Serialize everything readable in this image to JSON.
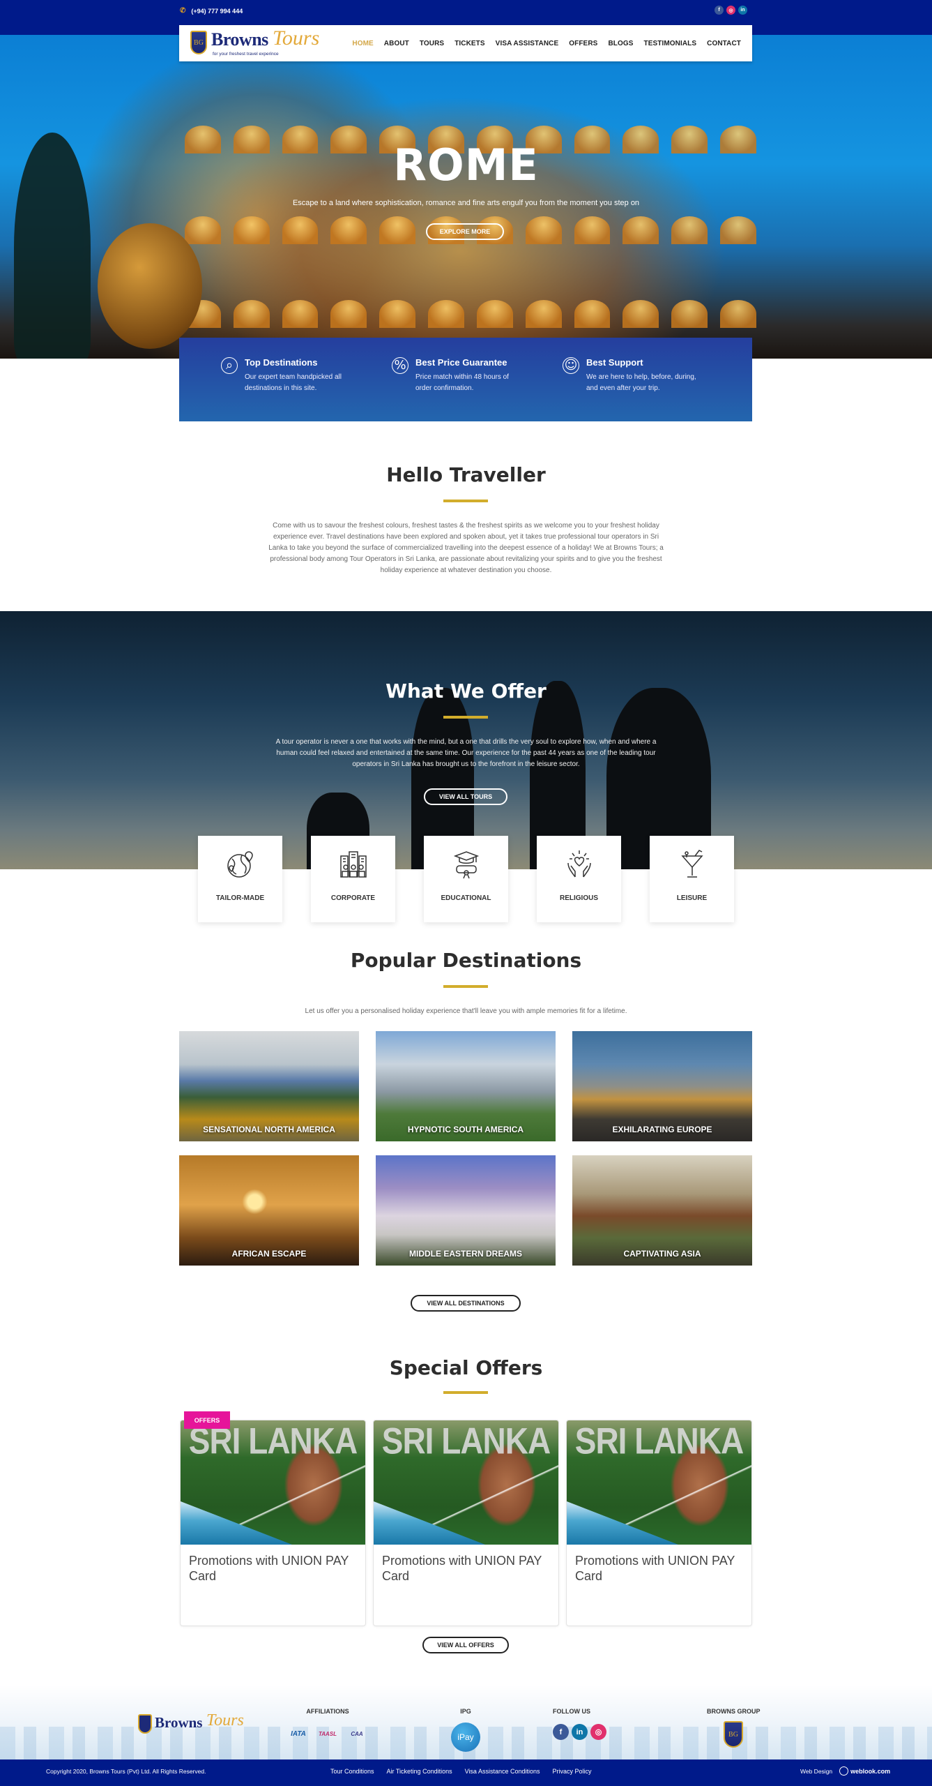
{
  "topbar": {
    "phone": "(+94) 777 994 444",
    "socials": [
      {
        "name": "facebook",
        "glyph": "f"
      },
      {
        "name": "instagram",
        "glyph": "◎"
      },
      {
        "name": "linkedin",
        "glyph": "in"
      }
    ]
  },
  "header": {
    "logo_brand": "Browns",
    "logo_script": "Tours",
    "logo_tagline": "for your freshest travel experince",
    "logo_monogram": "BG",
    "nav": [
      {
        "label": "HOME",
        "active": true
      },
      {
        "label": "ABOUT"
      },
      {
        "label": "TOURS"
      },
      {
        "label": "TICKETS"
      },
      {
        "label": "VISA ASSISTANCE"
      },
      {
        "label": "OFFERS"
      },
      {
        "label": "BLOGS"
      },
      {
        "label": "TESTIMONIALS"
      },
      {
        "label": "CONTACT"
      }
    ],
    "active_color": "#d4a84a"
  },
  "hero": {
    "title": "ROME",
    "subtitle": "Escape to a land where sophistication, romance and fine arts engulf you from the moment you step on",
    "button": "EXPLORE MORE"
  },
  "features": [
    {
      "icon": "globe-search-icon",
      "glyph": "⌕",
      "title": "Top Destinations",
      "text": "Our expert team handpicked all destinations in this site."
    },
    {
      "icon": "percent-badge-icon",
      "glyph": "%",
      "title": "Best Price Guarantee",
      "text": "Price match within 48 hours of order confirmation."
    },
    {
      "icon": "support-people-icon",
      "glyph": "☺",
      "title": "Best Support",
      "text": "We are here to help, before, during, and even after your trip."
    }
  ],
  "hello": {
    "title": "Hello Traveller",
    "text": "Come with us to savour the freshest colours, freshest tastes & the freshest spirits as we welcome you to your freshest holiday experience ever. Travel destinations have been explored and spoken about, yet it takes true professional tour operators in Sri Lanka to take you beyond the surface of commercialized travelling into the deepest essence of a holiday! We at Browns Tours; a professional body among Tour Operators in Sri Lanka, are passionate about revitalizing your spirits and to give you the freshest holiday experience at whatever destination you choose."
  },
  "offer": {
    "title": "What We Offer",
    "text": "A tour operator is never a one that works with the mind, but a one that drills the very soul to explore how, when and where a human could feel relaxed and entertained at the same time. Our experience for the past 44 years as one of the leading tour operators in Sri Lanka has brought us to the forefront in the leisure sector.",
    "button": "VIEW ALL TOURS",
    "categories": [
      {
        "label": "TAILOR-MADE",
        "icon": "globe-pins-icon"
      },
      {
        "label": "CORPORATE",
        "icon": "buildings-people-icon"
      },
      {
        "label": "EDUCATIONAL",
        "icon": "graduation-cap-icon"
      },
      {
        "label": "RELIGIOUS",
        "icon": "hands-heart-icon"
      },
      {
        "label": "LEISURE",
        "icon": "cocktail-icon"
      }
    ]
  },
  "destinations": {
    "title": "Popular Destinations",
    "subtitle": "Let us offer you a personalised holiday experience that'll leave you with ample memories fit for a lifetime.",
    "items": [
      {
        "label": "SENSATIONAL NORTH AMERICA"
      },
      {
        "label": "HYPNOTIC SOUTH AMERICA"
      },
      {
        "label": "EXHILARATING EUROPE"
      },
      {
        "label": "AFRICAN ESCAPE"
      },
      {
        "label": "MIDDLE EASTERN DREAMS"
      },
      {
        "label": "CAPTIVATING ASIA"
      }
    ],
    "button": "VIEW ALL DESTINATIONS"
  },
  "special_offers": {
    "title": "Special Offers",
    "badge": "OFFERS",
    "badge_color": "#e6149a",
    "items": [
      {
        "image_text": "SRI LANKA",
        "title": "Promotions with UNION PAY Card"
      },
      {
        "image_text": "SRI LANKA",
        "title": "Promotions with UNION PAY Card"
      },
      {
        "image_text": "SRI LANKA",
        "title": "Promotions with UNION PAY Card"
      }
    ],
    "button": "VIEW ALL OFFERS"
  },
  "footer": {
    "affiliations_heading": "AFFILIATIONS",
    "affiliations": [
      "IATA",
      "TAASL",
      "CAA"
    ],
    "ipg_heading": "IPG",
    "ipg_label": "iPay",
    "follow_heading": "FOLLOW US",
    "follow": [
      {
        "name": "facebook",
        "glyph": "f"
      },
      {
        "name": "linkedin",
        "glyph": "in"
      },
      {
        "name": "instagram",
        "glyph": "◎"
      }
    ],
    "group_heading": "BROWNS GROUP",
    "group_monogram": "BG",
    "copyright": "Copyright 2020, Browns Tours (Pvt) Ltd. All Rights Reserved.",
    "links": [
      "Tour Conditions",
      "Air Ticketing Conditions",
      "Visa Assistance Conditions",
      "Privacy Policy"
    ],
    "web_design_label": "Web Design",
    "web_design_brand": "weblook.com"
  },
  "colors": {
    "primary_navy": "#001a8a",
    "accent_gold": "#d2ad2c",
    "panel_blue": "#253e9e"
  }
}
